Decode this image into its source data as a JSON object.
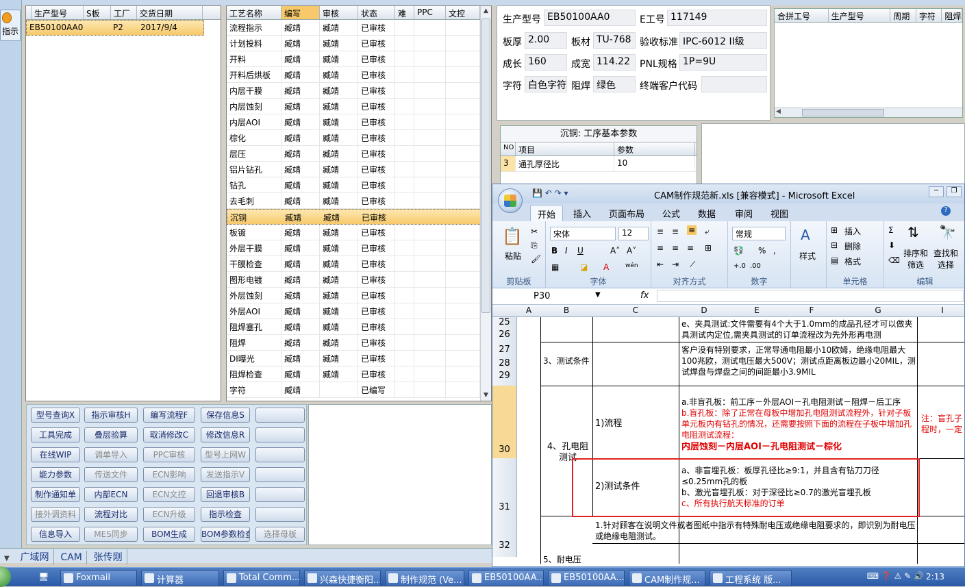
{
  "left_strip": {
    "button_label": "指示"
  },
  "order_grid": {
    "headers": [
      "生产型号",
      "S板",
      "工厂",
      "交货日期"
    ],
    "rows": [
      [
        "EB50100AA0",
        "",
        "P2",
        "2017/9/4"
      ]
    ]
  },
  "process_grid": {
    "headers": [
      "工艺名称",
      "编写",
      "审核",
      "状态",
      "难",
      "PPC",
      "文控"
    ],
    "rows": [
      [
        "流程指示",
        "臧靖",
        "臧靖",
        "已审核"
      ],
      [
        "计划投料",
        "臧靖",
        "臧靖",
        "已审核"
      ],
      [
        "开料",
        "臧靖",
        "臧靖",
        "已审核"
      ],
      [
        "开料后烘板",
        "臧靖",
        "臧靖",
        "已审核"
      ],
      [
        "内层干膜",
        "臧靖",
        "臧靖",
        "已审核"
      ],
      [
        "内层蚀刻",
        "臧靖",
        "臧靖",
        "已审核"
      ],
      [
        "内层AOI",
        "臧靖",
        "臧靖",
        "已审核"
      ],
      [
        "棕化",
        "臧靖",
        "臧靖",
        "已审核"
      ],
      [
        "层压",
        "臧靖",
        "臧靖",
        "已审核"
      ],
      [
        "铝片钻孔",
        "臧靖",
        "臧靖",
        "已审核"
      ],
      [
        "钻孔",
        "臧靖",
        "臧靖",
        "已审核"
      ],
      [
        "去毛刺",
        "臧靖",
        "臧靖",
        "已审核"
      ],
      [
        "沉铜",
        "臧靖",
        "臧靖",
        "已审核"
      ],
      [
        "板镀",
        "臧靖",
        "臧靖",
        "已审核"
      ],
      [
        "外层干膜",
        "臧靖",
        "臧靖",
        "已审核"
      ],
      [
        "干膜检查",
        "臧靖",
        "臧靖",
        "已审核"
      ],
      [
        "图形电镀",
        "臧靖",
        "臧靖",
        "已审核"
      ],
      [
        "外层蚀刻",
        "臧靖",
        "臧靖",
        "已审核"
      ],
      [
        "外层AOI",
        "臧靖",
        "臧靖",
        "已审核"
      ],
      [
        "阻焊塞孔",
        "臧靖",
        "臧靖",
        "已审核"
      ],
      [
        "阻焊",
        "臧靖",
        "臧靖",
        "已审核"
      ],
      [
        "DI曝光",
        "臧靖",
        "臧靖",
        "已审核"
      ],
      [
        "阻焊检查",
        "臧靖",
        "臧靖",
        "已审核"
      ],
      [
        "字符",
        "臧靖",
        "",
        "已编写"
      ]
    ]
  },
  "buttons": [
    [
      "型号查询X",
      "指示审核H",
      "编写流程F",
      "保存信息S",
      ""
    ],
    [
      "工具完成",
      "叠层验算",
      "取消修改C",
      "修改信息R",
      ""
    ],
    [
      "在线WIP",
      "调单导入",
      "PPC审核",
      "型号上网W",
      ""
    ],
    [
      "能力参数",
      "传送文件",
      "ECN影响",
      "发送指示V",
      ""
    ],
    [
      "制作通知单",
      "内部ECN",
      "ECN文控",
      "回退审核B",
      ""
    ],
    [
      "接外调资料",
      "流程对比",
      "ECN升级",
      "指示检查",
      ""
    ],
    [
      "信息导入",
      "MES同步",
      "BOM生成",
      "BOM参数检查",
      "选择母板"
    ]
  ],
  "bottom_tabs": [
    "广域网",
    "CAM",
    "张传刚"
  ],
  "form": {
    "model_label": "生产型号",
    "model": "EB50100AA0",
    "eno_label": "E工号",
    "eno": "117149",
    "thick_label": "板厚",
    "thick": "2.00",
    "mat_label": "板材",
    "mat": "TU-768",
    "std_label": "验收标准",
    "std": "IPC-6012 II级",
    "len_label": "成长",
    "len": "160",
    "wid_label": "成宽",
    "wid": "114.22",
    "pnl_label": "PNL规格",
    "pnl": "1P=9U",
    "char_label": "字符",
    "char": "白色字符",
    "mask_label": "阻焊",
    "mask": "绿色",
    "cust_label": "终端客户代码",
    "cust": ""
  },
  "merge_grid": {
    "headers": [
      "合拼工号",
      "生产型号",
      "周期",
      "字符",
      "阻焊"
    ]
  },
  "params": {
    "title": "沉铜: 工序基本参数",
    "headers": [
      "NO",
      "项目",
      "参数"
    ],
    "rows": [
      [
        "3",
        "通孔厚径比",
        "10"
      ]
    ]
  },
  "excel": {
    "title": "CAM制作规范新.xls  [兼容模式] - Microsoft Excel",
    "tabs": [
      "开始",
      "插入",
      "页面布局",
      "公式",
      "数据",
      "审阅",
      "视图"
    ],
    "font_name": "宋体",
    "font_size": "12",
    "number_format": "常规",
    "group_labels": [
      "剪贴板",
      "字体",
      "对齐方式",
      "数字",
      "单元格",
      "编辑"
    ],
    "paste": "粘贴",
    "style": "样式",
    "insert": "插入",
    "delete": "删除",
    "format": "格式",
    "sort": "排序和筛选",
    "find": "查找和选择",
    "name_box": "P30",
    "columns": [
      "A",
      "B",
      "C",
      "D",
      "E",
      "F",
      "G",
      "I"
    ],
    "rows": [
      "25",
      "26",
      "27",
      "28",
      "29",
      "30",
      "31",
      "32"
    ],
    "cells": {
      "r25": "e、夹具测试:文件需要有4个大于1.0mm的成品孔径才可以做夹具测试内定位,需夹具测试的订单流程改为先外形再电测",
      "b27": "3、测试条件",
      "d27": "客户没有特别要求，正常导通电阻最小10欧姆，绝缘电阻最大100兆欧，测试电压最大500V；测试点距离板边最小20MIL，测试焊盘与焊盘之间的间距最小3.9MIL",
      "b30": "4、孔电阻测试",
      "c30": "1)流程",
      "d30a": "a.非盲孔板：前工序－外层AOI－孔电阻测试－阻焊－后工序",
      "d30b": "b.盲孔板：除了正常在母板中增加孔电阻测试流程外，针对子板单元板内有钻孔的情况，还需要按照下面的流程在子板中增加孔电阻测试流程：",
      "d30c": "内层蚀刻－内层AOI－孔电阻测试－棕化",
      "i30": "注：盲孔子程时，一定",
      "c31": "2)测试条件",
      "d31a": "a、非盲埋孔板：板厚孔径比≥9:1，并且含有钻刀刀径≤0.25mm孔的板",
      "d31b": "b、激光盲埋孔板：对于深径比≥0.7的激光盲埋孔板",
      "d31c": "c、所有执行航天标准的订单",
      "d32": "1.针对顾客在说明文件或者图纸中指示有特殊耐电压或绝缘电阻要求的，即识别为耐电压或绝缘电阻测试。",
      "b33": "5、耐电压"
    }
  },
  "taskbar": {
    "items": [
      "Foxmail",
      "计算器",
      "Total Comm...",
      "兴森快捷衡阳...",
      "制作规范 (Ve...",
      "EB50100AA...",
      "EB50100AA...",
      "CAM制作规...",
      "工程系统  版..."
    ],
    "clock": "2:13"
  }
}
